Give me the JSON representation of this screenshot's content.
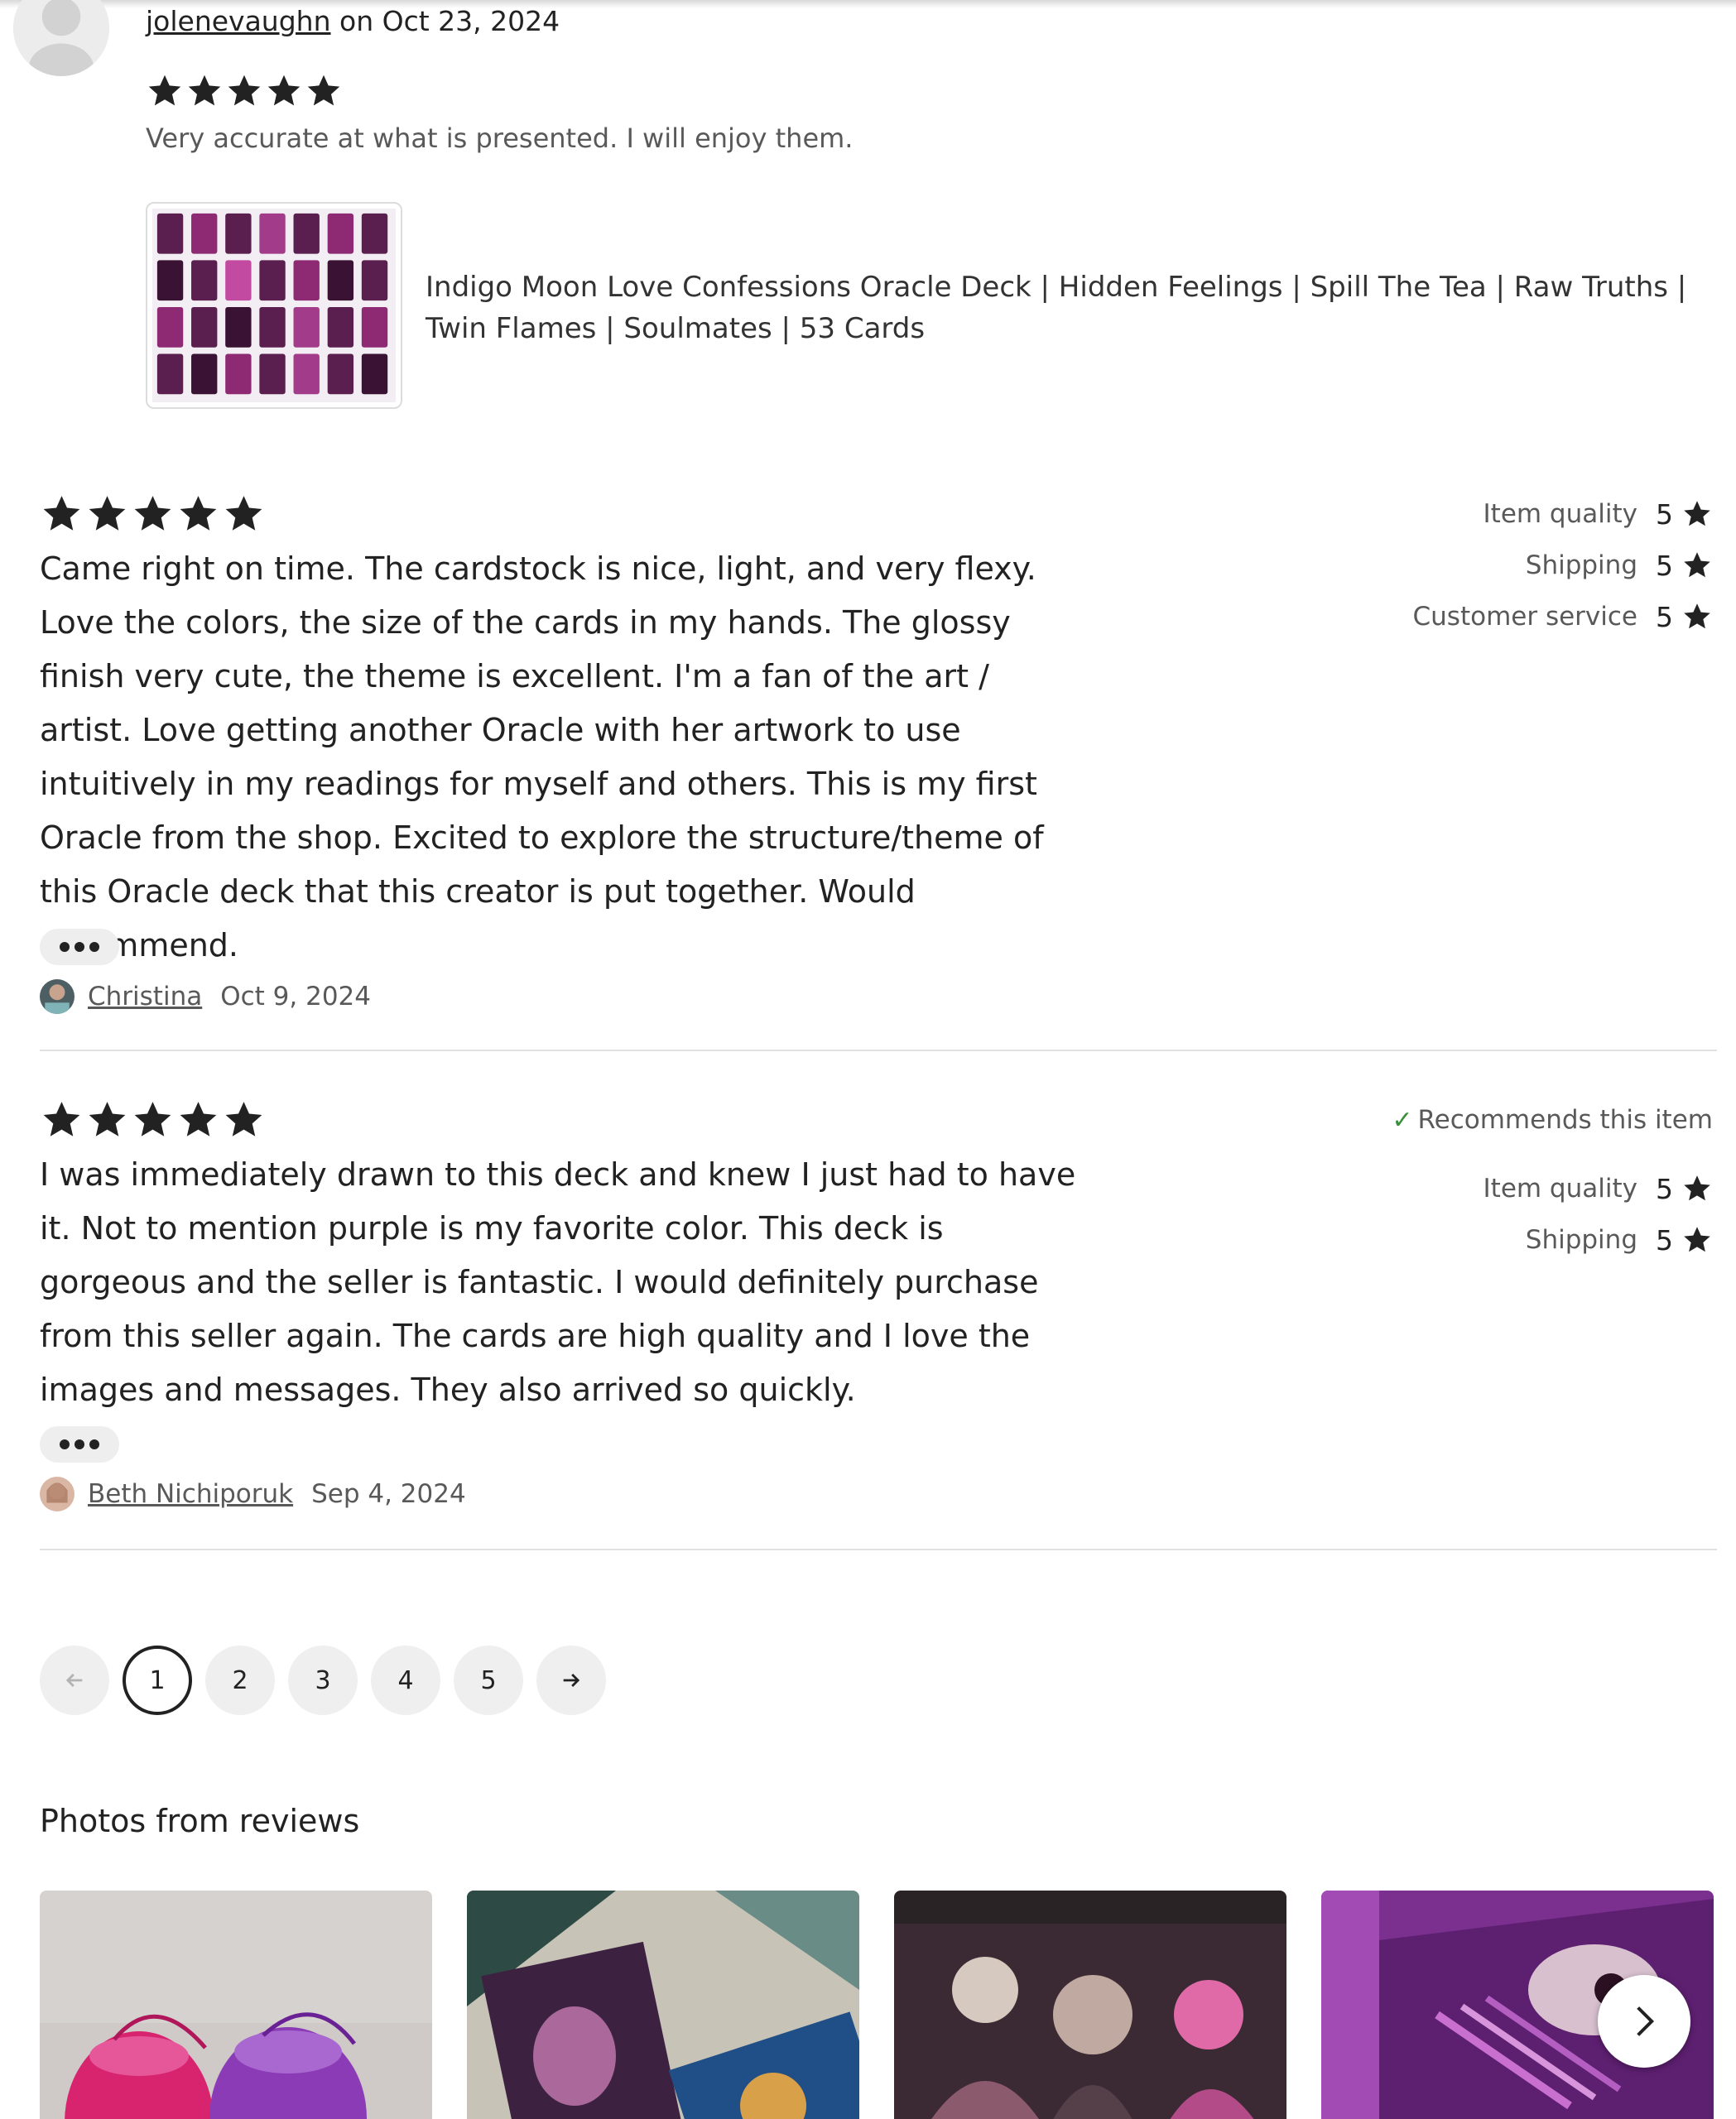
{
  "first_review": {
    "username": "jolenevaughn",
    "date_text": "on Oct 23, 2024",
    "rating": 5,
    "text": "Very accurate at what is presented. I will enjoy them.",
    "product_title": "Indigo Moon Love Confessions Oracle Deck | Hidden Feelings | Spill The Tea | Raw Truths | Twin Flames | Soulmates | 53 Cards"
  },
  "reviews": [
    {
      "rating": 5,
      "text": "Came right on time. The cardstock is nice, light, and very flexy. Love the colors, the size of the cards in my hands. The glossy finish very cute, the theme is excellent. I'm a fan of the art / artist. Love getting another Oracle with her artwork to use intuitively in my readings for myself and others. This is my first Oracle from the shop. Excited to explore the structure/theme of this Oracle deck that this creator is put together. Would recommend.",
      "author": "Christina",
      "date": "Oct 9, 2024",
      "recommends": "",
      "ratings": [
        {
          "label": "Item quality",
          "value": "5"
        },
        {
          "label": "Shipping",
          "value": "5"
        },
        {
          "label": "Customer service",
          "value": "5"
        }
      ]
    },
    {
      "rating": 5,
      "text": "I was immediately drawn to this deck and knew I just had to have it. Not to mention purple is my favorite color. This deck is gorgeous and the seller is fantastic. I would definitely purchase from this seller again. The cards are high quality and I love the images and messages. They also arrived so quickly.",
      "author": "Beth Nichiporuk",
      "date": "Sep 4, 2024",
      "recommends": "Recommends this item",
      "ratings": [
        {
          "label": "Item quality",
          "value": "5"
        },
        {
          "label": "Shipping",
          "value": "5"
        }
      ]
    }
  ],
  "pagination": {
    "prev_icon": "arrow-left-icon",
    "pages": [
      "1",
      "2",
      "3",
      "4",
      "5"
    ],
    "current": "1",
    "next_icon": "arrow-right-icon"
  },
  "photos": {
    "heading": "Photos from reviews",
    "next_icon": "chevron-right-icon"
  },
  "colors": {
    "star": "#222222",
    "check": "#3a8f3a",
    "muted_text": "#595959"
  }
}
